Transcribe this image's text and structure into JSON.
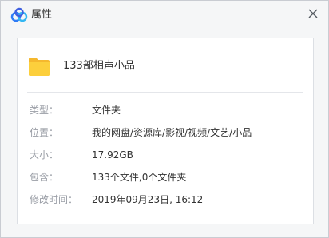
{
  "window": {
    "title": "属性",
    "app_icon": "baidu-netdisk-cloud-icon",
    "close_icon": "close-icon"
  },
  "item": {
    "icon": "folder-icon",
    "icon_color": "#f7c533",
    "name": "133部相声小品"
  },
  "properties": [
    {
      "label": "类型：",
      "value": "文件夹"
    },
    {
      "label": "位置：",
      "value": "我的网盘/资源库/影视/视频/文艺/小品"
    },
    {
      "label": "大小：",
      "value": "17.92GB"
    },
    {
      "label": "包含：",
      "value": "133个文件,0个文件夹"
    },
    {
      "label": "修改时间：",
      "value": "2019年09月23日, 16:12"
    }
  ]
}
